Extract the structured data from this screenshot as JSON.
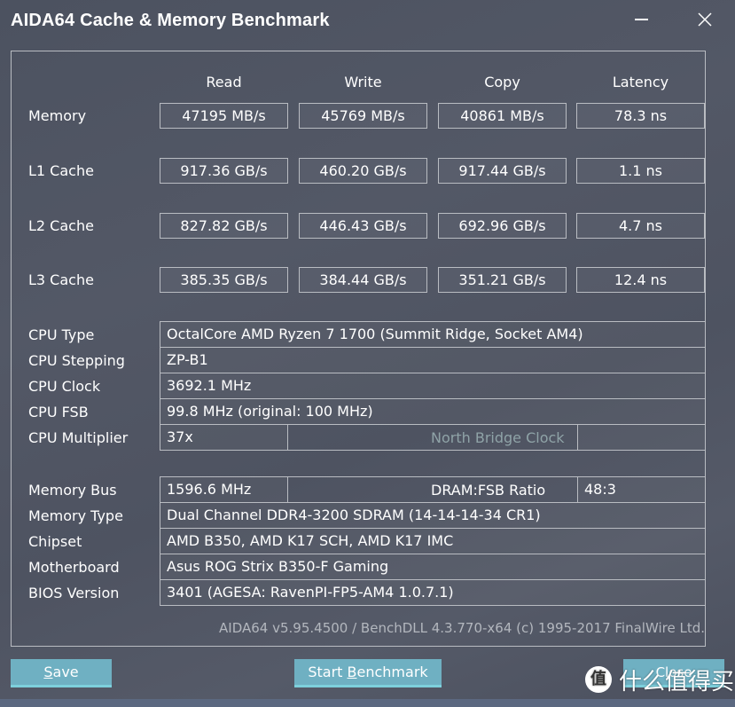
{
  "window": {
    "title": "AIDA64 Cache & Memory Benchmark",
    "minimize_icon": "minimize-icon",
    "close_icon": "close-icon"
  },
  "benchmark": {
    "columns": [
      "Read",
      "Write",
      "Copy",
      "Latency"
    ],
    "rows": [
      {
        "label": "Memory",
        "values": [
          "47195 MB/s",
          "45769 MB/s",
          "40861 MB/s",
          "78.3 ns"
        ]
      },
      {
        "label": "L1 Cache",
        "values": [
          "917.36 GB/s",
          "460.20 GB/s",
          "917.44 GB/s",
          "1.1 ns"
        ]
      },
      {
        "label": "L2 Cache",
        "values": [
          "827.82 GB/s",
          "446.43 GB/s",
          "692.96 GB/s",
          "4.7 ns"
        ]
      },
      {
        "label": "L3 Cache",
        "values": [
          "385.35 GB/s",
          "384.44 GB/s",
          "351.21 GB/s",
          "12.4 ns"
        ]
      }
    ]
  },
  "cpu_info": {
    "cpu_type": {
      "label": "CPU Type",
      "value": "OctalCore AMD Ryzen 7 1700  (Summit Ridge, Socket AM4)"
    },
    "cpu_stepping": {
      "label": "CPU Stepping",
      "value": "ZP-B1"
    },
    "cpu_clock": {
      "label": "CPU Clock",
      "value": "3692.1 MHz"
    },
    "cpu_fsb": {
      "label": "CPU FSB",
      "value": "99.8 MHz  (original: 100 MHz)"
    },
    "cpu_multiplier": {
      "label": "CPU Multiplier",
      "value": "37x"
    },
    "north_bridge_clock": {
      "label": "North Bridge Clock",
      "value": ""
    }
  },
  "memory_info": {
    "memory_bus": {
      "label": "Memory Bus",
      "value": "1596.6 MHz"
    },
    "dram_fsb_ratio": {
      "label": "DRAM:FSB Ratio",
      "value": "48:3"
    },
    "memory_type": {
      "label": "Memory Type",
      "value": "Dual Channel DDR4-3200 SDRAM  (14-14-14-34 CR1)"
    },
    "chipset": {
      "label": "Chipset",
      "value": "AMD B350, AMD K17 SCH, AMD K17 IMC"
    },
    "motherboard": {
      "label": "Motherboard",
      "value": "Asus ROG Strix B350-F Gaming"
    },
    "bios_version": {
      "label": "BIOS Version",
      "value": "3401  (AGESA: RavenPI-FP5-AM4 1.0.7.1)"
    }
  },
  "footer": {
    "version_text": "AIDA64 v5.95.4500 / BenchDLL 4.3.770-x64  (c) 1995-2017 FinalWire Ltd."
  },
  "buttons": {
    "save": {
      "mnemonic": "S",
      "rest": "ave"
    },
    "start_benchmark": {
      "pre": "Start ",
      "mnemonic": "B",
      "rest": "enchmark"
    },
    "close": {
      "label": "Close"
    }
  },
  "watermark": {
    "icon_char": "值",
    "text": "什么值得买"
  },
  "colors": {
    "button_bg": "#6fb0c2",
    "button_accent": "#7dd0dc",
    "border": "#b9bcc2",
    "disabled_label": "#8fa3a7"
  }
}
